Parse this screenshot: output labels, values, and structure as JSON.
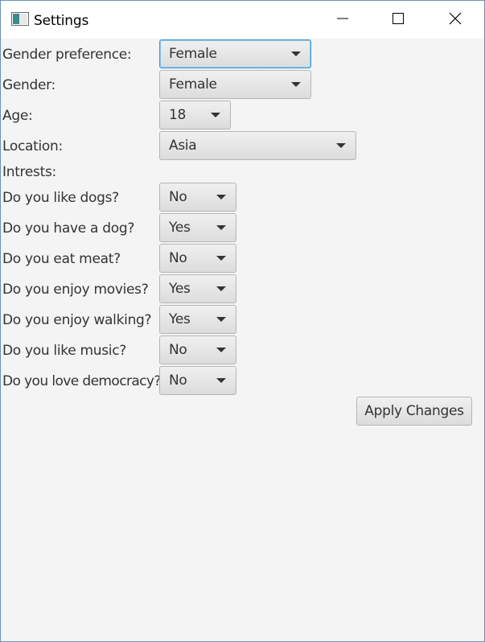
{
  "window": {
    "title": "Settings"
  },
  "form": {
    "gender_preference": {
      "label": "Gender preference:",
      "value": "Female"
    },
    "gender": {
      "label": "Gender:",
      "value": "Female"
    },
    "age": {
      "label": "Age:",
      "value": "18"
    },
    "location": {
      "label": "Location:",
      "value": "Asia"
    },
    "interests_heading": "Intrests:",
    "questions": [
      {
        "label": "Do you like dogs?",
        "value": "No"
      },
      {
        "label": "Do you have a dog?",
        "value": "Yes"
      },
      {
        "label": "Do you eat meat?",
        "value": "No"
      },
      {
        "label": "Do you enjoy movies?",
        "value": "Yes"
      },
      {
        "label": "Do you enjoy walking?",
        "value": "Yes"
      },
      {
        "label": "Do you like music?",
        "value": "No"
      },
      {
        "label": "Do you love democracy?",
        "value": "No"
      }
    ],
    "apply_label": "Apply Changes"
  },
  "icons": {
    "app": "window-app-icon",
    "minimize": "minimize-icon",
    "maximize": "maximize-icon",
    "close": "close-icon",
    "dropdown": "chevron-down-icon"
  },
  "colors": {
    "focus_border": "#3a9bd8",
    "background": "#f4f4f4",
    "text": "#333333"
  }
}
